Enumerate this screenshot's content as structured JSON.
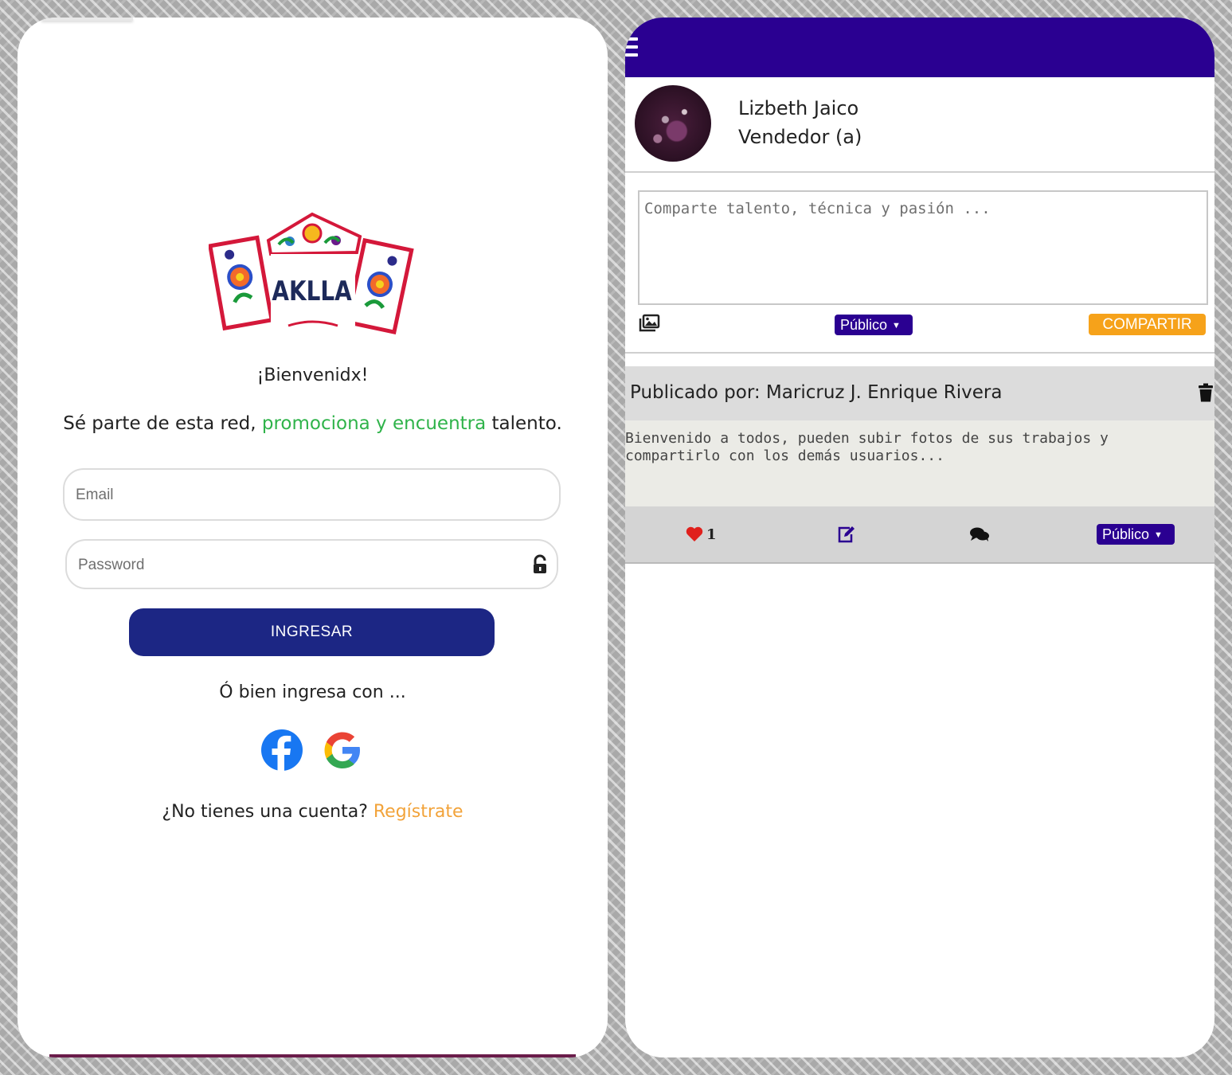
{
  "login": {
    "logo_text": "AKLLA",
    "welcome": "¡Bienvenidx!",
    "tagline_start": "Sé parte de esta red, ",
    "tagline_highlight": "promociona y encuentra",
    "tagline_end": " talento.",
    "email_placeholder": "Email",
    "password_placeholder": "Password",
    "submit_label": "INGRESAR",
    "or_text": "Ó bien ingresa con ...",
    "register_prompt": "¿No tienes una cuenta? ",
    "register_link": "Regístrate"
  },
  "feed": {
    "profile": {
      "name": "Lizbeth Jaico",
      "role": "Vendedor (a)"
    },
    "composer": {
      "placeholder": "Comparte talento, técnica y pasión ...",
      "visibility": "Público",
      "share_label": "COMPARTIR"
    },
    "post": {
      "author": "Publicado por: Maricruz J. Enrique Rivera",
      "body": "Bienvenido a todos, pueden subir fotos de sus trabajos y\ncompartirlo con los demás usuarios...",
      "likes": "1",
      "visibility": "Público"
    }
  },
  "colors": {
    "brand_navy": "#1c2684",
    "topbar_purple": "#2a0091",
    "accent_green": "#2fb34a",
    "accent_orange": "#f6a21a",
    "link_orange": "#f2a33a"
  },
  "icons": [
    "hamburger-icon",
    "image-upload-icon",
    "lock-icon",
    "facebook-icon",
    "google-icon",
    "trash-icon",
    "heart-icon",
    "edit-icon",
    "comment-icon",
    "caret-down-icon"
  ]
}
